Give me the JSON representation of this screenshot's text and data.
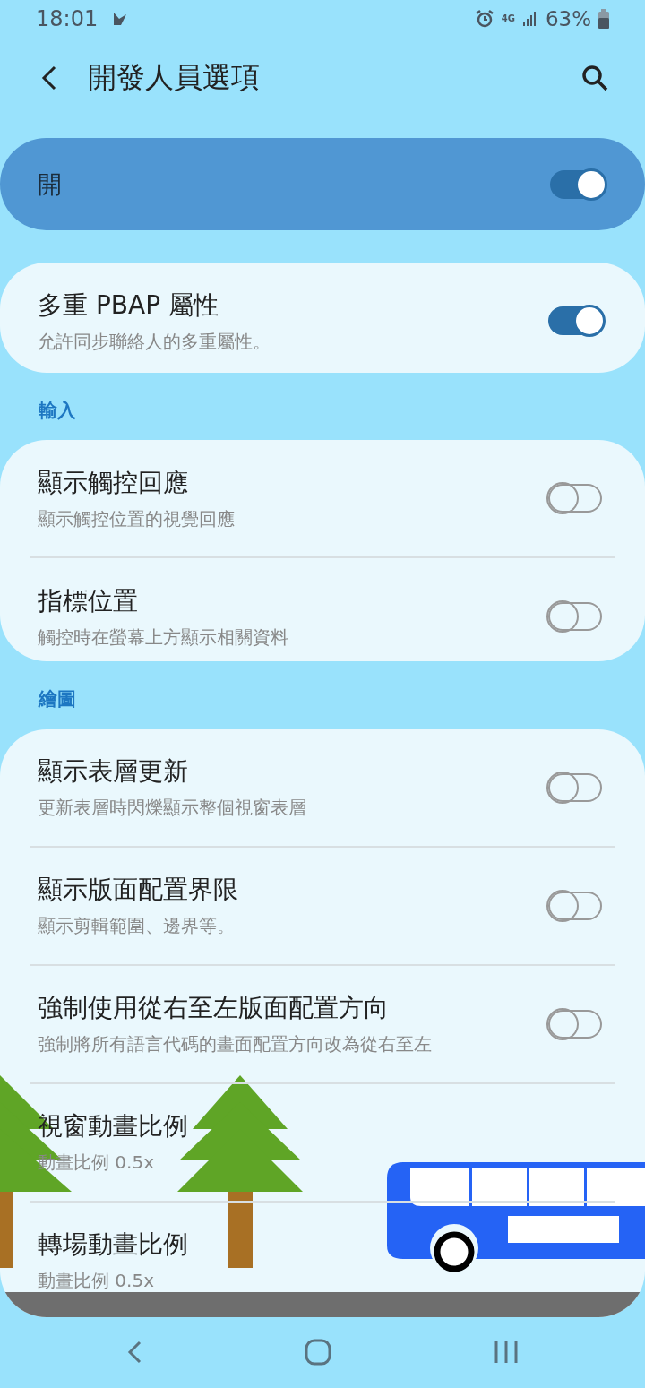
{
  "status_bar": {
    "time": "18:01",
    "network": "4G",
    "battery": "63%"
  },
  "header": {
    "title": "開發人員選項"
  },
  "master": {
    "label": "開",
    "on": true
  },
  "top_group": [
    {
      "title": "多重 PBAP 屬性",
      "subtitle": "允許同步聯絡人的多重屬性。",
      "kind": "switch",
      "on": true
    }
  ],
  "sections": [
    {
      "title": "輸入",
      "items": [
        {
          "title": "顯示觸控回應",
          "subtitle": "顯示觸控位置的視覺回應",
          "kind": "switch",
          "on": false
        },
        {
          "title": "指標位置",
          "subtitle": "觸控時在螢幕上方顯示相關資料",
          "kind": "switch",
          "on": false
        }
      ]
    },
    {
      "title": "繪圖",
      "items": [
        {
          "title": "顯示表層更新",
          "subtitle": "更新表層時閃爍顯示整個視窗表層",
          "kind": "switch",
          "on": false
        },
        {
          "title": "顯示版面配置界限",
          "subtitle": "顯示剪輯範圍、邊界等。",
          "kind": "switch",
          "on": false
        },
        {
          "title": "強制使用從右至左版面配置方向",
          "subtitle": "強制將所有語言代碼的畫面配置方向改為從右至左",
          "kind": "switch",
          "on": false
        },
        {
          "title": "視窗動畫比例",
          "subtitle": "動畫比例 0.5x",
          "kind": "value"
        },
        {
          "title": "轉場動畫比例",
          "subtitle": "動畫比例 0.5x",
          "kind": "value"
        }
      ]
    }
  ]
}
